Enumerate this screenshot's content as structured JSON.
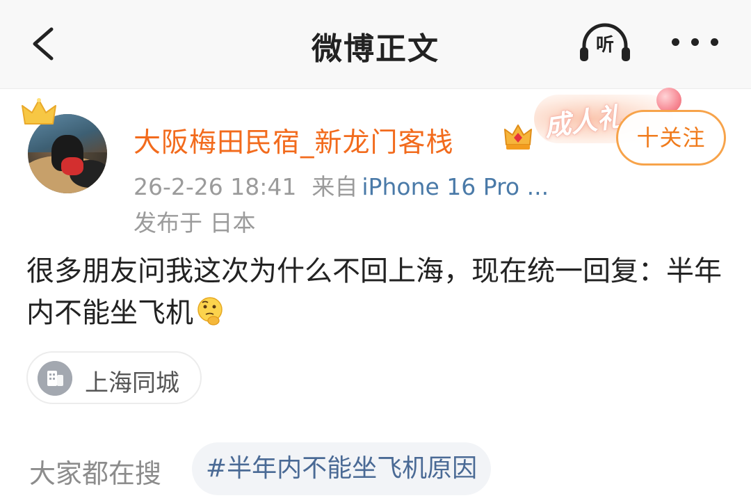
{
  "header": {
    "title": "微博正文",
    "listen_label": "听"
  },
  "author": {
    "name": "大阪梅田民宿_新龙门客栈",
    "follow_label": "十关注",
    "promo_sticker_text": "成人礼"
  },
  "post": {
    "timestamp": "26-2-26 18:41",
    "source_prefix": "来自",
    "device": "iPhone 16 Pro ...",
    "location": "发布于 日本",
    "text": "很多朋友问我这次为什么不回上海，现在统一回复：半年内不能坐飞机"
  },
  "topic_chip": {
    "label": "上海同城"
  },
  "trending": {
    "label": "大家都在搜",
    "tag": "#半年内不能坐飞机原因"
  },
  "colors": {
    "username": "#f26b1d",
    "follow_border": "#f7a34a",
    "link": "#4a7aa8",
    "meta": "#9b9b9b"
  },
  "icons": {
    "back": "chevron-left-icon",
    "listen": "headphones-icon",
    "more": "more-dots-icon",
    "crown": "crown-icon",
    "vip": "vip-crown-badge-icon",
    "emoji": "thinking-face-emoji",
    "chip": "building-icon"
  }
}
